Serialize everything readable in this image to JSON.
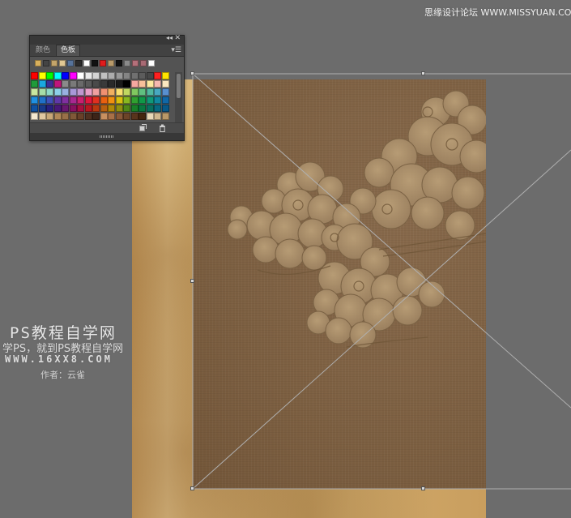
{
  "watermark": {
    "site_title": "思缘设计论坛 WWW.MISSYUAN.COM",
    "ps_title": "PS教程自学网",
    "tagline": "学PS，就到PS教程自学网",
    "url": "WWW.16XX8.COM",
    "author": "作者：云雀"
  },
  "panel": {
    "collapse_icon": "double-chevron-icon",
    "close_icon": "close-icon",
    "tabs": [
      {
        "label": "颜色",
        "active": false
      },
      {
        "label": "色板",
        "active": true
      }
    ],
    "menu_icon": "panel-menu-icon",
    "recent_swatches": [
      "#d8b05c",
      "#444444",
      "#c4a56a",
      "#e0c894",
      "#56739b",
      "#2b2b2b",
      "#ffffff",
      "#111111",
      "#e01c1c",
      "#b89a6a",
      "#111111",
      "#8a8a8a",
      "#b4707a",
      "#a86a74",
      "#ffffff"
    ],
    "swatch_rows": [
      [
        "#ff0000",
        "#ffff00",
        "#00ff00",
        "#00ffff",
        "#0000ff",
        "#ff00ff",
        "#ffffff",
        "#e8e8e8",
        "#d4d4d4",
        "#c0c0c0",
        "#acacac",
        "#989898",
        "#848484",
        "#707070",
        "#5c5c5c",
        "#484848",
        "#ff2020",
        "#ffe400"
      ],
      [
        "#1f9b3a",
        "#1aa8e0",
        "#3b2f96",
        "#c0147c",
        "#8a8a8a",
        "#7a7a7a",
        "#6a6a6a",
        "#5a5a5a",
        "#4a4a4a",
        "#3a3a3a",
        "#2a2a2a",
        "#1a1a1a",
        "#000000",
        "#f7a8a0",
        "#f9c09a",
        "#fde8a0",
        "#f5b8b0",
        "#fbe8c0"
      ],
      [
        "#c8e6a0",
        "#a6dca8",
        "#8fd8c8",
        "#8cd0e8",
        "#98b0e0",
        "#a898d8",
        "#c098d0",
        "#e8a0c8",
        "#f0a0a0",
        "#f09070",
        "#f0b060",
        "#f8e070",
        "#c0d860",
        "#80c860",
        "#60c080",
        "#50b8a0",
        "#48a8c0",
        "#5890d0"
      ],
      [
        "#2090e0",
        "#2070c8",
        "#4050b8",
        "#6038a8",
        "#8030a0",
        "#a82890",
        "#c82070",
        "#e01840",
        "#e03020",
        "#e86010",
        "#f09010",
        "#d8c010",
        "#88b820",
        "#30a030",
        "#109848",
        "#109878",
        "#1088a0",
        "#1068a8"
      ],
      [
        "#1050a0",
        "#183888",
        "#282080",
        "#481878",
        "#681870",
        "#881060",
        "#a81040",
        "#b81820",
        "#b83810",
        "#b86010",
        "#b08808",
        "#909010",
        "#508818",
        "#188028",
        "#087840",
        "#087060",
        "#086880",
        "#085888"
      ],
      [
        "#f4e8d0",
        "#e0c8a0",
        "#c8a878",
        "#b08858",
        "#987048",
        "#805838",
        "#684028",
        "#503020",
        "#3c2418",
        "#c89060",
        "#a87048",
        "#885838",
        "#6c4428",
        "#58341c",
        "#44260f",
        "#e8d8b8",
        "#d0b890",
        "#b89868"
      ]
    ],
    "footer_icons": [
      "new-swatch-icon",
      "trash-icon"
    ]
  },
  "canvas": {
    "document": "antique-paper-texture",
    "layer": "cloud-pattern-layer",
    "transform_mode": "free-transform"
  }
}
